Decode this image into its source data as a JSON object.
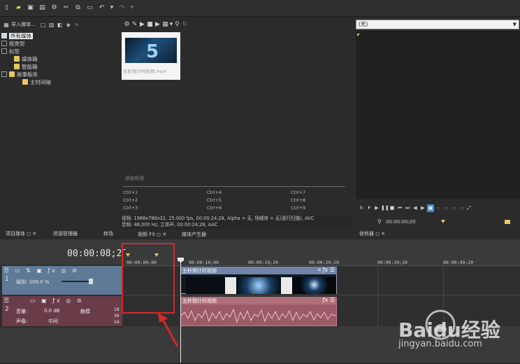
{
  "left_panel": {
    "import_label": "导入媒体...",
    "tree": [
      "所有媒体",
      "按类型",
      "标签",
      "媒体箱",
      "智能箱",
      "故事板库",
      "主时间轴"
    ]
  },
  "media": {
    "thumb_caption": "五秒倒计时视频.mp4",
    "add_tag_hint": "添加标签",
    "shortcuts": [
      "Ctrl+1",
      "Ctrl+4",
      "Ctrl+7",
      "Ctrl+2",
      "Ctrl+5",
      "Ctrl+8",
      "Ctrl+3",
      "Ctrl+6",
      "Ctrl+9"
    ],
    "info_video": "视频: 1988x788x32, 25.000 fps, 00:00:24;28, Alpha = 无, 场顺序 = 无(逐行扫描), AVC",
    "info_audio": "音频: 48,000 Hz, 立体声, 00:00:24;28, AAC"
  },
  "preview": {
    "select_value": "(无)",
    "timecode": "00:00:00;00"
  },
  "tabs": [
    "项目媒体",
    "资源管理器",
    "转场",
    "视频 FX",
    "媒体产生器",
    "修剪器"
  ],
  "timeline": {
    "current_timecode": "00:00:08;22",
    "ruler_labels": [
      "00:00:00;00",
      "00:00:10;00",
      "00:00:19;29",
      "00:00:29;29",
      "00:00:39;29",
      "00:00:49;29"
    ],
    "video_track": {
      "number": "1",
      "level_label": "级别: 100.0 %"
    },
    "audio_track": {
      "number": "2",
      "volume_label": "音量:",
      "volume_value": "0.0 dB",
      "pan_label": "声像:",
      "pan_value": "中间",
      "mode_label": "触摸",
      "scale": [
        "18",
        "36",
        "54"
      ]
    },
    "video_clip_title": "五秒倒计时视频",
    "audio_clip_title": "五秒倒计时视频"
  },
  "watermark": {
    "brand": "Baidu经验",
    "url": "jingyan.baidu.com"
  },
  "colors": {
    "highlight": "#d42a2a",
    "video_clip": "#7184a7",
    "audio_clip": "#9c5a66",
    "accent": "#3b8fd9"
  }
}
